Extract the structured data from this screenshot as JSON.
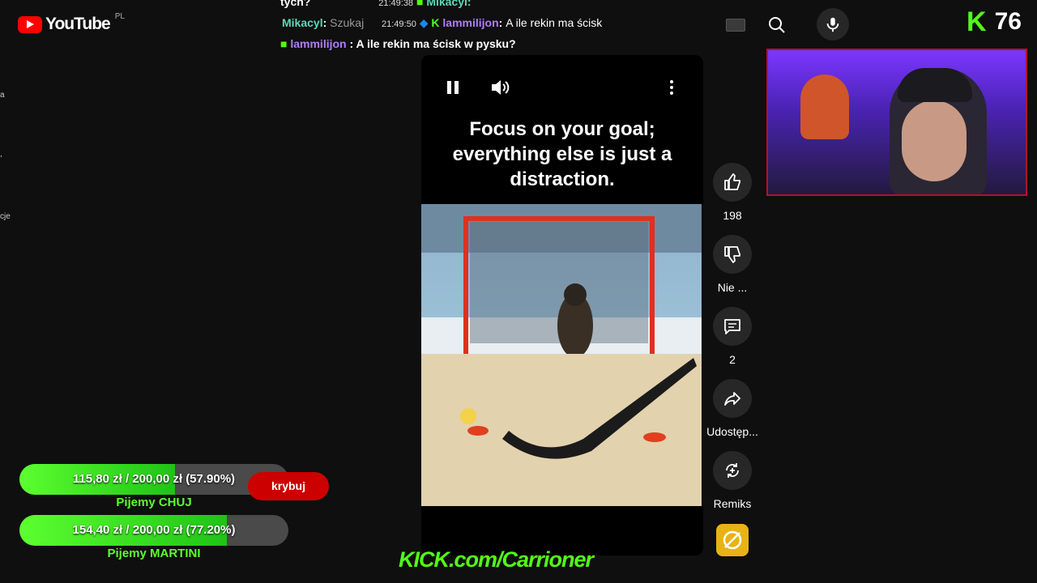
{
  "youtube": {
    "logo_text": "YouTube",
    "country": "PL"
  },
  "left_fragments": [
    "a",
    ",",
    "cje"
  ],
  "chat": {
    "top_partial": {
      "text": "tych?",
      "time": "21:49:38",
      "user": "Mikacyl:"
    },
    "row1": {
      "user": "Mikacyl",
      "suffix": "Szukaj",
      "time": "21:49:50",
      "user2": "lammilijon",
      "msg": "A ile rekin ma ścisk"
    },
    "row2": {
      "user": "lammilijon",
      "msg": "A ile rekin ma ścisk w pysku?"
    }
  },
  "search": {
    "keyboard_icon": "keyboard-icon",
    "search_icon": "search-icon",
    "mic_icon": "mic-icon"
  },
  "kick": {
    "viewer_count": "76",
    "logo_letter": "K",
    "url": "KICK.com/Carrioner"
  },
  "short": {
    "quote": "Focus on your goal; everything else is just a distraction."
  },
  "actions": {
    "like": "198",
    "dislike": "Nie ...",
    "comments": "2",
    "share": "Udostęp...",
    "remix": "Remiks"
  },
  "goals": [
    {
      "text": "115,80 zł / 200,00 zł (57.90%)",
      "fraction": 0.579,
      "label": "Pijemy CHUJ"
    },
    {
      "text": "154,40 zł / 200,00 zł (77.20%)",
      "fraction": 0.772,
      "label": "Pijemy MARTINI"
    }
  ],
  "subscribe_label": "krybuj",
  "colors": {
    "kick_green": "#53fc18",
    "youtube_red": "#ff0000",
    "goal_green": "#5cff2f"
  }
}
